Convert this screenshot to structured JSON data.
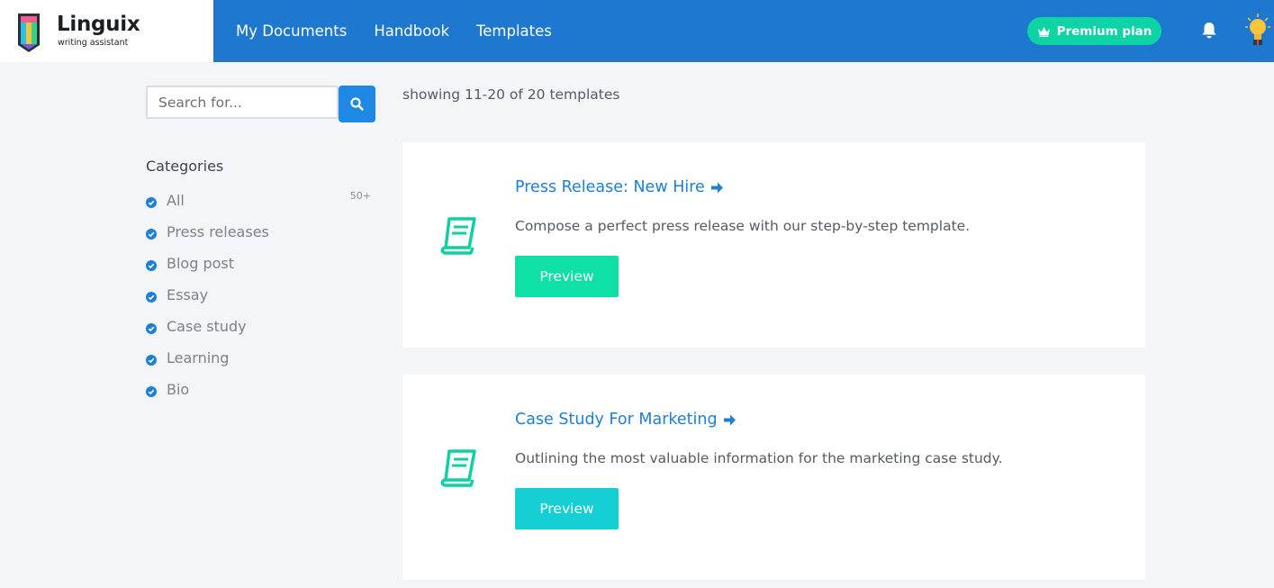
{
  "header": {
    "logo": {
      "word": "Linguix",
      "subtitle": "writing assistant"
    },
    "nav": [
      {
        "label": "My Documents"
      },
      {
        "label": "Handbook"
      },
      {
        "label": "Templates"
      }
    ],
    "premium_label": "Premium plan",
    "icons": {
      "premium": "crown-icon",
      "notifications": "bell-icon",
      "avatar": "lightbulb-avatar-icon"
    }
  },
  "sidebar": {
    "search": {
      "placeholder": "Search for...",
      "value": ""
    },
    "categories_title": "Categories",
    "categories": [
      {
        "label": "All",
        "count": "50+"
      },
      {
        "label": "Press releases"
      },
      {
        "label": "Blog post"
      },
      {
        "label": "Essay"
      },
      {
        "label": "Case study"
      },
      {
        "label": "Learning"
      },
      {
        "label": "Bio"
      }
    ]
  },
  "main": {
    "showing": "showing 11-20 of 20 templates",
    "templates": [
      {
        "title": "Press Release: New Hire",
        "description": "Compose a perfect press release with our step-by-step template.",
        "button": "Preview",
        "button_color": "#0ee0a6"
      },
      {
        "title": "Case Study For Marketing",
        "description": "Outlining the most valuable information for the marketing case study.",
        "button": "Preview",
        "button_color": "#14cfd3"
      }
    ]
  },
  "colors": {
    "header_bg": "#1e78d0",
    "accent_blue": "#1d7fd6",
    "accent_green": "#0dd3a5",
    "icon_teal": "#10cfa3"
  }
}
